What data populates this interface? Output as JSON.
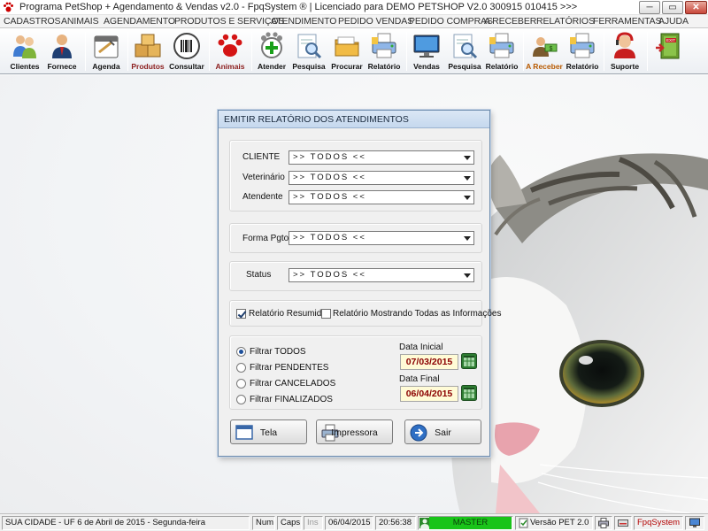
{
  "window": {
    "title": "Programa PetShop + Agendamento & Vendas v2.0 - FpqSystem ® | Licenciado para  DEMO PETSHOP V2.0 300915 010415 >>>",
    "min_label": "0",
    "max_label": "▭",
    "close_label": "✕"
  },
  "menu": [
    "CADASTROS",
    "ANIMAIS",
    "AGENDAMENTO",
    "PRODUTOS E SERVIÇOS",
    "ATENDIMENTO",
    "PEDIDO VENDAS",
    "PEDIDO COMPRAS",
    "A RECEBER",
    "RELATÓRIOS",
    "FERRAMENTAS",
    "AJUDA"
  ],
  "toolbar": [
    {
      "label": "Clientes",
      "icon": "users-icon"
    },
    {
      "label": "Fornece",
      "icon": "supplier-icon"
    },
    {
      "label": "Agenda",
      "icon": "calendar-icon"
    },
    {
      "label": "Produtos",
      "icon": "boxes-icon"
    },
    {
      "label": "Consultar",
      "icon": "barcode-icon"
    },
    {
      "label": "Animais",
      "icon": "paw-icon"
    },
    {
      "label": "Atender",
      "icon": "paw-add-icon"
    },
    {
      "label": "Pesquisa",
      "icon": "search-document-icon"
    },
    {
      "label": "Procurar",
      "icon": "folder-icon"
    },
    {
      "label": "Relatório",
      "icon": "printer-report-icon"
    },
    {
      "label": "Vendas",
      "icon": "monitor-icon"
    },
    {
      "label": "Pesquisa",
      "icon": "search-document-icon"
    },
    {
      "label": "Relatório",
      "icon": "printer-report-icon"
    },
    {
      "label": "A Receber",
      "icon": "money-icon"
    },
    {
      "label": "Relatório",
      "icon": "printer-report-icon"
    },
    {
      "label": "Suporte",
      "icon": "support-agent-icon"
    },
    {
      "label": "",
      "icon": "exit-door-icon"
    }
  ],
  "dialog": {
    "title": "EMITIR RELATÓRIO DOS ATENDIMENTOS",
    "cliente_label": "CLIENTE",
    "cliente_value": ">> TODOS <<",
    "veterinario_label": "Veterinário",
    "veterinario_value": ">> TODOS <<",
    "atendente_label": "Atendente",
    "atendente_value": ">> TODOS <<",
    "forma_pgto_label": "Forma Pgto",
    "forma_pgto_value": ">> TODOS <<",
    "status_label": "Status",
    "status_value": ">> TODOS <<",
    "relatorio_resumido": {
      "label": "Relatório Resumido",
      "checked": true
    },
    "relatorio_todas": {
      "label": "Relatório Mostrando Todas as Informações",
      "checked": false
    },
    "filtros": [
      {
        "label": "Filtrar TODOS",
        "selected": true
      },
      {
        "label": "Filtrar PENDENTES",
        "selected": false
      },
      {
        "label": "Filtrar CANCELADOS",
        "selected": false
      },
      {
        "label": "Filtrar FINALIZADOS",
        "selected": false
      }
    ],
    "data_inicial_label": "Data Inicial",
    "data_inicial": "07/03/2015",
    "data_final_label": "Data Final",
    "data_final": "06/04/2015",
    "btn_tela": "Tela",
    "btn_impressora": "Impressora",
    "btn_sair": "Sair"
  },
  "status": {
    "location": "SUA CIDADE - UF  6 de Abril de 2015 - Segunda-feira",
    "num": "Num",
    "caps": "Caps",
    "ins": "Ins",
    "date": "06/04/2015",
    "time": "20:56:38",
    "user": "MASTER",
    "version": "Versão PET 2.0",
    "brand": "FpqSystem"
  },
  "colors": {
    "date_text": "#8b0000",
    "date_bg": "#fffbd6",
    "status_green": "#19c419",
    "brand_red": "#b30000"
  }
}
